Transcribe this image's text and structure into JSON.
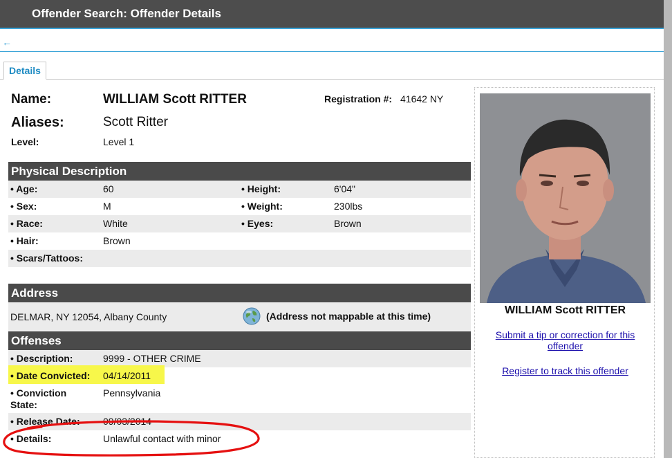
{
  "header": {
    "title": "Offender Search: Offender Details"
  },
  "tabs": [
    {
      "label": "Details"
    }
  ],
  "offender": {
    "name_label": "Name:",
    "name": "WILLIAM Scott RITTER",
    "aliases_label": "Aliases:",
    "aliases": "Scott Ritter",
    "level_label": "Level:",
    "level": "Level 1",
    "registration_label": "Registration #:",
    "registration": "41642 NY"
  },
  "physical": {
    "title": "Physical Description",
    "age_label": "• Age:",
    "age": "60",
    "height_label": "• Height:",
    "height": "6'04\"",
    "sex_label": "• Sex:",
    "sex": "M",
    "weight_label": "• Weight:",
    "weight": "230lbs",
    "race_label": "• Race:",
    "race": "White",
    "eyes_label": "• Eyes:",
    "eyes": "Brown",
    "hair_label": "• Hair:",
    "hair": "Brown",
    "scars_label": "• Scars/Tattoos:",
    "scars": ""
  },
  "address": {
    "title": "Address",
    "value": "DELMAR, NY 12054, Albany County",
    "map_note": "(Address not mappable at this time)"
  },
  "offenses": {
    "title": "Offenses",
    "description_label": "• Description:",
    "description": "9999 - OTHER CRIME",
    "date_label": "• Date Convicted:",
    "date": "04/14/2011",
    "state_label": "• Conviction",
    "state_label2": "State:",
    "state": "Pennsylvania",
    "release_label": "• Release Date:",
    "release": "09/03/2014",
    "details_label": "• Details:",
    "details": "Unlawful contact with minor"
  },
  "sidebar": {
    "photo_caption": "WILLIAM Scott RITTER",
    "tip_link_line1": "Submit a tip or correction for this",
    "tip_link_line2": "offender",
    "track_link": "Register to track this offender"
  },
  "colors": {
    "header_bg": "#4d4d4d",
    "accent": "#3ba4d8",
    "highlight": "#f7f74a",
    "annotation": "#e51010"
  }
}
